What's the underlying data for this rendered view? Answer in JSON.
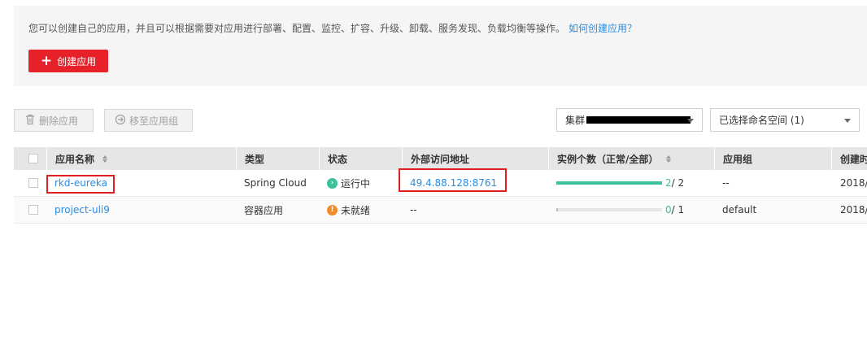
{
  "banner": {
    "description": "您可以创建自己的应用，并且可以根据需要对应用进行部署、配置、监控、扩容、升级、卸载、服务发现、负载均衡等操作。",
    "help_link": "如何创建应用？",
    "create_button": "创建应用"
  },
  "toolbar": {
    "delete_button": "删除应用",
    "move_button": "移至应用组",
    "cluster_select_prefix": "集群",
    "namespace_select": "已选择命名空间 (1)"
  },
  "table": {
    "headers": {
      "name": "应用名称",
      "type": "类型",
      "status": "状态",
      "address": "外部访问地址",
      "instances": "实例个数（正常/全部）",
      "group": "应用组",
      "created": "创建时"
    },
    "rows": [
      {
        "name": "rkd-eureka",
        "type": "Spring Cloud",
        "status": "运行中",
        "address": "49.4.88.128:8761",
        "instances_normal": "2",
        "instances_total": "/ 2",
        "instance_ratio": 1.0,
        "group": "--",
        "created": "2018/"
      },
      {
        "name": "project-uli9",
        "type": "容器应用",
        "status": "未就绪",
        "address": "--",
        "instances_normal": "0",
        "instances_total": "/ 1",
        "instance_ratio": 0.0,
        "group": "default",
        "created": "2018/"
      }
    ]
  },
  "colors": {
    "brand_red": "#e6212a",
    "link_blue": "#2a8ce3",
    "running_green": "#3cc19a",
    "pending_orange": "#f08c2a",
    "annotation_red": "#e02020"
  }
}
